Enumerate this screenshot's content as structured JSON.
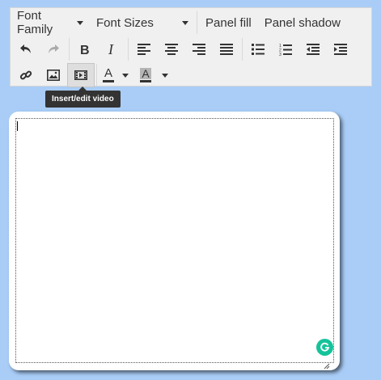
{
  "toolbar": {
    "font_family_label": "Font Family",
    "font_sizes_label": "Font Sizes",
    "panel_fill_label": "Panel fill",
    "panel_shadow_label": "Panel shadow",
    "buttons": [
      "undo",
      "redo",
      "bold",
      "italic",
      "align-left",
      "align-center",
      "align-right",
      "justify",
      "bullet-list",
      "numbered-list",
      "outdent",
      "indent",
      "link",
      "image",
      "video",
      "text-color",
      "background-color"
    ],
    "text_color_letter": "A",
    "bg_color_letter": "A",
    "active_button": "video"
  },
  "tooltip": {
    "text": "Insert/edit video"
  },
  "editor": {
    "content": ""
  },
  "colors": {
    "page_bg": "#a9cdf7",
    "toolbar_bg": "#f0f0f0",
    "grammarly": "#15c39a",
    "tooltip_bg": "#333333"
  },
  "icons": [
    "undo-icon",
    "redo-icon",
    "bold-icon",
    "italic-icon",
    "align-left-icon",
    "align-center-icon",
    "align-right-icon",
    "justify-icon",
    "bullet-list-icon",
    "numbered-list-icon",
    "outdent-icon",
    "indent-icon",
    "link-icon",
    "image-icon",
    "video-icon",
    "text-color-icon",
    "background-color-icon",
    "grammarly-icon"
  ]
}
